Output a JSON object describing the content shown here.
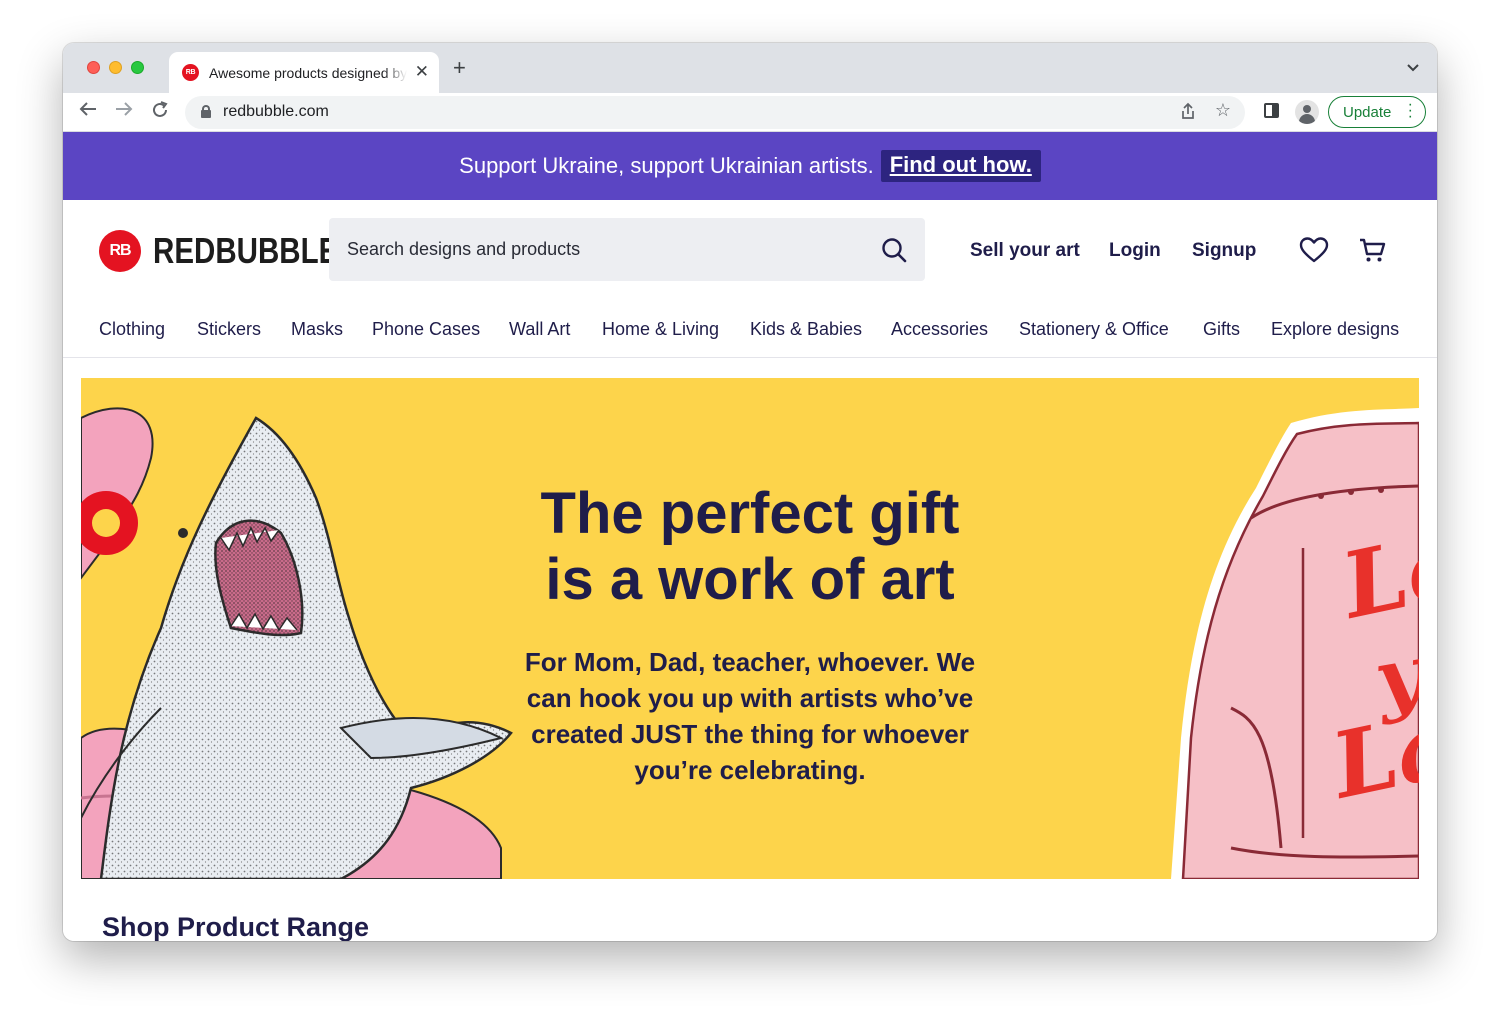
{
  "browser": {
    "tab_title": "Awesome products designed by independent artists",
    "favicon_text": "RB",
    "new_tab": "+",
    "url": "redbubble.com",
    "update_label": "Update"
  },
  "banner": {
    "text": "Support Ukraine, support Ukrainian artists.",
    "link": "Find out how."
  },
  "header": {
    "logo_mark": "RB",
    "logo_text": "REDBUBBLE",
    "search_placeholder": "Search designs and products",
    "links": {
      "sell": "Sell your art",
      "login": "Login",
      "signup": "Signup"
    }
  },
  "categories": [
    "Clothing",
    "Stickers",
    "Masks",
    "Phone Cases",
    "Wall Art",
    "Home & Living",
    "Kids & Babies",
    "Accessories",
    "Stationery & Office",
    "Gifts",
    "Explore designs"
  ],
  "hero": {
    "title_line1": "The perfect gift",
    "title_line2": "is a work of art",
    "subtitle": "For Mom, Dad, teacher, whoever. We can hook you up with artists who’ve created JUST the thing for whoever you’re celebrating.",
    "jacket_lettering": "Love ya Lady",
    "background_color": "#fdd44b"
  },
  "section": {
    "title": "Shop Product Range"
  },
  "colors": {
    "banner": "#5b45c3",
    "banner_link_bg": "#2d2480",
    "brand_red": "#e41321",
    "navy_text": "#1f1d4a",
    "update_green": "#188038"
  }
}
